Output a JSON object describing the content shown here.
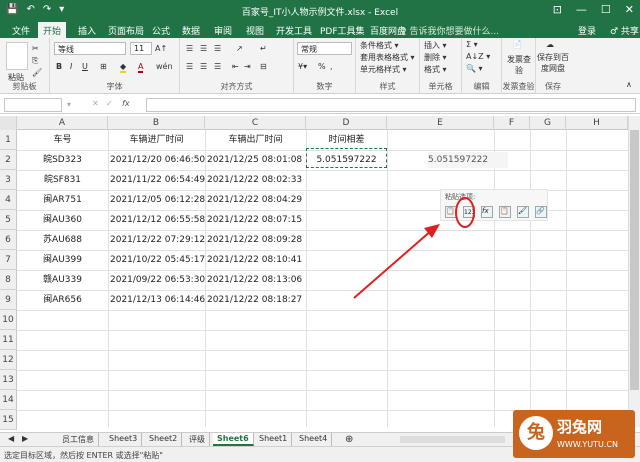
{
  "window": {
    "title": "百家号_IT小人物示例文件.xlsx - Excel",
    "quick_access": [
      "💾",
      "↶",
      "↷",
      "▾"
    ],
    "controls": [
      "⊡",
      "—",
      "☐",
      "✕"
    ]
  },
  "tabs": {
    "items": [
      "文件",
      "开始",
      "插入",
      "页面布局",
      "公式",
      "数据",
      "审阅",
      "视图",
      "开发工具",
      "PDF工具集",
      "百度网盘"
    ],
    "active": "开始",
    "tell_me": "♀ 告诉我你想要做什么...",
    "login": "登录",
    "share": "♂ 共享"
  },
  "ribbon": {
    "clipboard": {
      "paste": "粘贴",
      "label": "剪贴板"
    },
    "font": {
      "name": "等线",
      "size": "11",
      "bold": "B",
      "italic": "I",
      "underline": "U",
      "grow": "A↑",
      "shrink": "A↓",
      "font_color": "A",
      "wen": "wén",
      "label": "字体"
    },
    "alignment": {
      "label": "对齐方式"
    },
    "number": {
      "format": "常规",
      "percent": "%",
      "comma": ",",
      "label": "数字"
    },
    "styles": {
      "conditional": "条件格式 ▾",
      "table": "套用表格格式 ▾",
      "cell": "单元格样式 ▾",
      "label": "样式"
    },
    "cells": {
      "insert": "插入 ▾",
      "delete": "删除 ▾",
      "format": "格式 ▾",
      "label": "单元格"
    },
    "editing": {
      "sum": "Σ ▾",
      "sort": "A↓Z ▾",
      "find": "🔍 ▾",
      "label": "编辑"
    },
    "invoice": {
      "btn": "发票查验",
      "label": "发票查验"
    },
    "baidu": {
      "btn": "保存到百度网盘",
      "label": "保存"
    }
  },
  "formula_bar": {
    "name_box": "",
    "cancel": "✕",
    "enter": "✓",
    "fx": "fx",
    "value": ""
  },
  "columns": [
    "A",
    "B",
    "C",
    "D",
    "E",
    "F",
    "G",
    "H"
  ],
  "rows": [
    "1",
    "2",
    "3",
    "4",
    "5",
    "6",
    "7",
    "8",
    "9",
    "10",
    "11",
    "12",
    "13",
    "14",
    "15"
  ],
  "table": {
    "headers": [
      "车号",
      "车辆进厂时间",
      "车辆出厂时间",
      "时间相差"
    ],
    "rows": [
      [
        "皖SD323",
        "2021/12/20 06:46:50",
        "2021/12/25 08:01:08",
        "5.051597222"
      ],
      [
        "皖SF831",
        "2021/11/22 06:54:49",
        "2021/12/22 08:02:33",
        ""
      ],
      [
        "闽AR751",
        "2021/12/05 06:12:28",
        "2021/12/22 08:04:29",
        ""
      ],
      [
        "闽AU360",
        "2021/12/12 06:55:58",
        "2021/12/22 08:07:15",
        ""
      ],
      [
        "苏AU688",
        "2021/12/22 07:29:12",
        "2021/12/22 08:09:28",
        ""
      ],
      [
        "闽AU399",
        "2021/10/22 05:45:17",
        "2021/12/22 08:10:41",
        ""
      ],
      [
        "赣AU339",
        "2021/09/22 06:53:30",
        "2021/12/22 08:13:06",
        ""
      ],
      [
        "闽AR656",
        "2021/12/13 06:14:46",
        "2021/12/22 08:18:27",
        ""
      ]
    ]
  },
  "pasted_value": "5.051597222",
  "paste_options": {
    "label": "粘贴选项:",
    "icons": [
      "📋",
      "123",
      "fx",
      "📋",
      "🖌",
      "🔗"
    ]
  },
  "sheets": {
    "items": [
      "员工信息",
      "Sheet3",
      "Sheet2",
      "评级",
      "Sheet6",
      "Sheet1",
      "Sheet4"
    ],
    "active": "Sheet6",
    "add": "⊕"
  },
  "status_text": "选定目标区域，然后按 ENTER 或选择\"粘贴\"",
  "watermark": {
    "name": "羽兔网",
    "url": "WWW.YUTU.CN"
  },
  "colors": {
    "accent": "#217346",
    "annotation": "#e02020"
  }
}
